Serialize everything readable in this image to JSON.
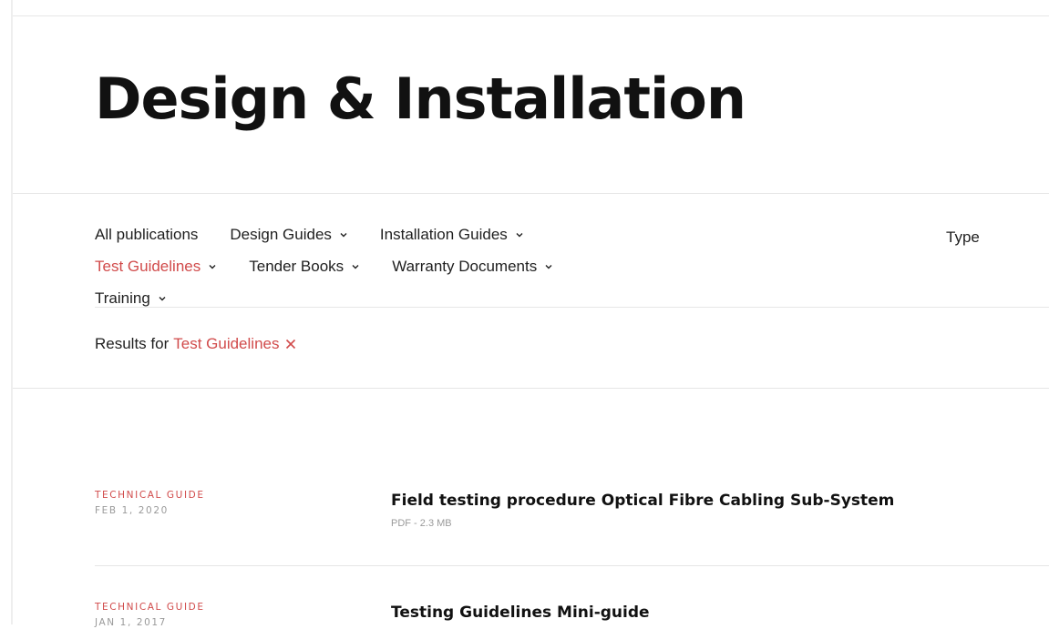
{
  "page": {
    "title": "Design & Installation"
  },
  "filters": {
    "items": [
      {
        "label": "All publications",
        "has_dropdown": false,
        "active": false
      },
      {
        "label": "Design Guides",
        "has_dropdown": true,
        "active": false
      },
      {
        "label": "Installation Guides",
        "has_dropdown": true,
        "active": false
      },
      {
        "label": "Test Guidelines",
        "has_dropdown": true,
        "active": true
      },
      {
        "label": "Tender Books",
        "has_dropdown": true,
        "active": false
      },
      {
        "label": "Warranty Documents",
        "has_dropdown": true,
        "active": false
      },
      {
        "label": "Training",
        "has_dropdown": true,
        "active": false
      }
    ],
    "type_label": "Type"
  },
  "results": {
    "prefix": "Results for",
    "term": "Test Guidelines",
    "clear_icon": "close-icon"
  },
  "documents": [
    {
      "category": "TECHNICAL GUIDE",
      "date": "FEB 1, 2020",
      "title": "Field testing procedure Optical Fibre Cabling Sub-System",
      "file_info": "PDF - 2.3 MB"
    },
    {
      "category": "TECHNICAL GUIDE",
      "date": "JAN 1, 2017",
      "title": "Testing Guidelines Mini-guide",
      "file_info": ""
    }
  ],
  "colors": {
    "accent": "#d14b4b",
    "text": "#1f1f1f",
    "muted": "#9a9a9a",
    "divider": "#e6e6e6"
  }
}
